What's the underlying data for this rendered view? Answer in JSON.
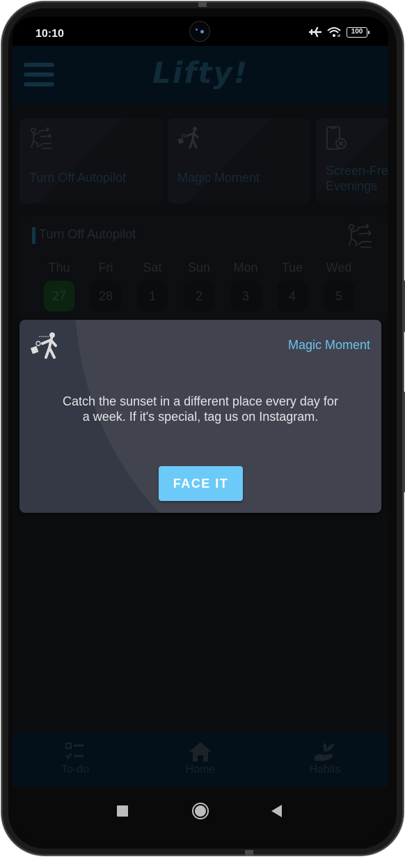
{
  "status_bar": {
    "time": "10:10",
    "battery": "100",
    "icons": [
      "airplane-mode-icon",
      "wifi-icon",
      "battery-icon"
    ]
  },
  "app_bar": {
    "title": "Lifty!",
    "menu_icon": "hamburger-menu-icon"
  },
  "habit_cards": [
    {
      "label": "Turn Off Autopilot",
      "icon": "climbing-arrows-icon"
    },
    {
      "label": "Magic Moment",
      "icon": "walking-person-suitcase-icon"
    },
    {
      "label": "Screen-Free Evenings",
      "label_visible": "Screen-Fre",
      "label_line2": "Evenings",
      "icon": "phone-off-icon"
    }
  ],
  "habit_section": {
    "title": "Turn Off Autopilot",
    "icon": "climbing-arrows-icon",
    "days": [
      {
        "name": "Thu",
        "num": "27",
        "today": true
      },
      {
        "name": "Fri",
        "num": "28"
      },
      {
        "name": "Sat",
        "num": "1"
      },
      {
        "name": "Sun",
        "num": "2"
      },
      {
        "name": "Mon",
        "num": "3"
      },
      {
        "name": "Tue",
        "num": "4"
      },
      {
        "name": "Wed",
        "num": "5"
      }
    ]
  },
  "dialog": {
    "category": "Magic Moment",
    "icon": "walking-person-suitcase-icon",
    "message": "Catch the sunset in a different place every day for a week. If it's special, tag us on Instagram.",
    "button_label": "FACE IT",
    "accent_color": "#6cc2ec",
    "button_color": "#6ccaf8"
  },
  "bottom_nav": {
    "items": [
      {
        "label": "To-do",
        "icon": "checklist-icon"
      },
      {
        "label": "Home",
        "icon": "home-icon"
      },
      {
        "label": "Habits",
        "icon": "hand-plant-icon"
      }
    ]
  },
  "system_nav": {
    "buttons": [
      "recents",
      "home",
      "back"
    ]
  }
}
